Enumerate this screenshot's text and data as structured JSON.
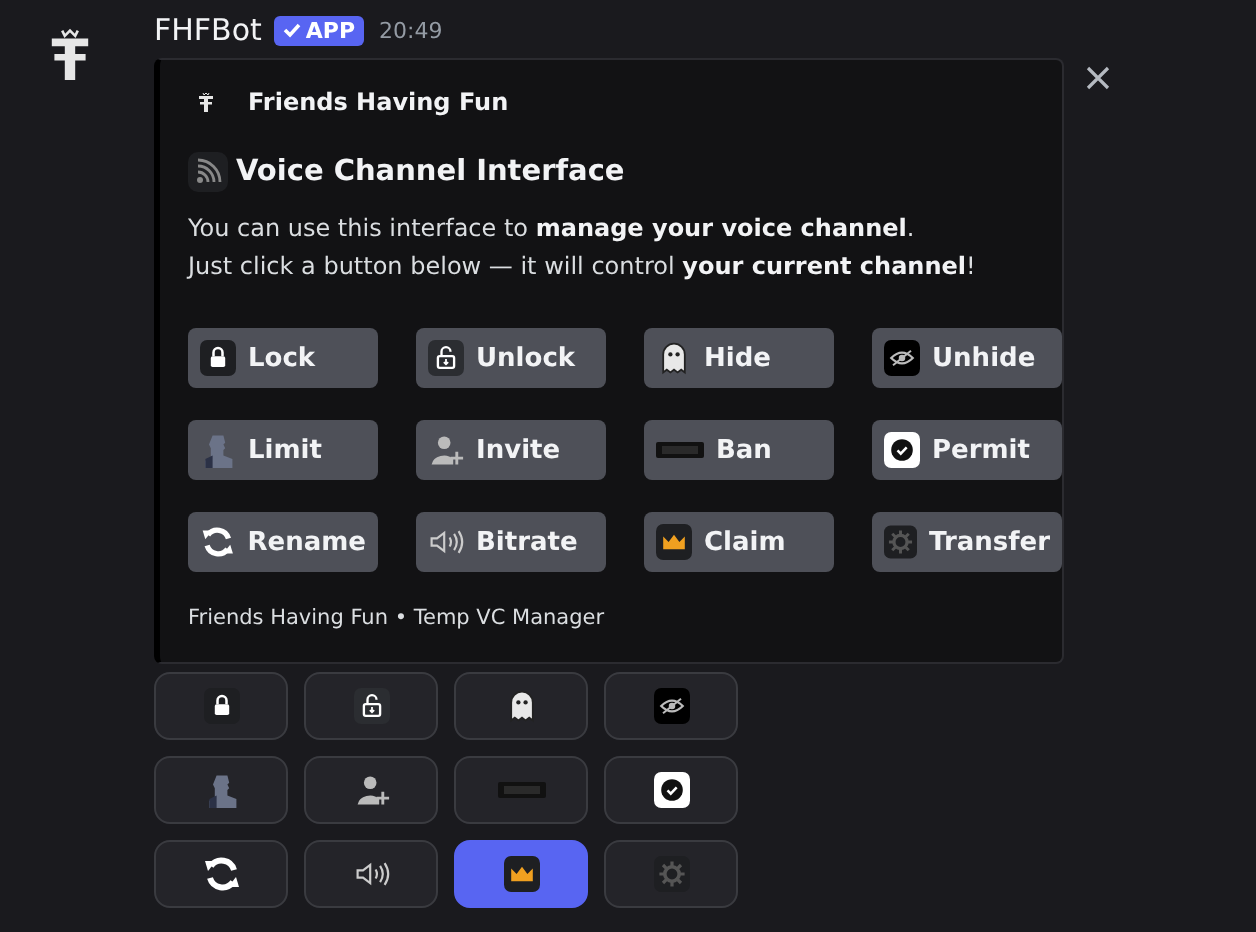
{
  "message": {
    "author": "FHFBot",
    "badge": "APP",
    "time": "20:49"
  },
  "embed": {
    "author": "Friends Having Fun",
    "title": "Voice Channel Interface",
    "description": "You can use this interface to **manage your voice channel**.\nJust click a button below — it will control **your current channel**!",
    "buttons": [
      {
        "label": "Lock",
        "kind": "lock"
      },
      {
        "label": "Unlock",
        "kind": "unlock"
      },
      {
        "label": "Hide",
        "kind": "ghost"
      },
      {
        "label": "Unhide",
        "kind": "eye"
      },
      {
        "label": "Limit",
        "kind": "statue"
      },
      {
        "label": "Invite",
        "kind": "addperson"
      },
      {
        "label": "Ban",
        "kind": "bar"
      },
      {
        "label": "Permit",
        "kind": "check"
      },
      {
        "label": "Rename",
        "kind": "refresh"
      },
      {
        "label": "Bitrate",
        "kind": "speaker"
      },
      {
        "label": "Claim",
        "kind": "crown"
      },
      {
        "label": "Transfer",
        "kind": "gear"
      }
    ],
    "footer": "Friends Having Fun • Temp VC Manager"
  },
  "components": [
    {
      "kind": "lock",
      "selected": false
    },
    {
      "kind": "unlock",
      "selected": false
    },
    {
      "kind": "ghost",
      "selected": false
    },
    {
      "kind": "eye",
      "selected": false
    },
    {
      "kind": "statue",
      "selected": false
    },
    {
      "kind": "addperson",
      "selected": false
    },
    {
      "kind": "bar",
      "selected": false
    },
    {
      "kind": "check",
      "selected": false
    },
    {
      "kind": "refresh",
      "selected": false
    },
    {
      "kind": "speaker",
      "selected": false
    },
    {
      "kind": "crown",
      "selected": true
    },
    {
      "kind": "gear",
      "selected": false
    }
  ]
}
